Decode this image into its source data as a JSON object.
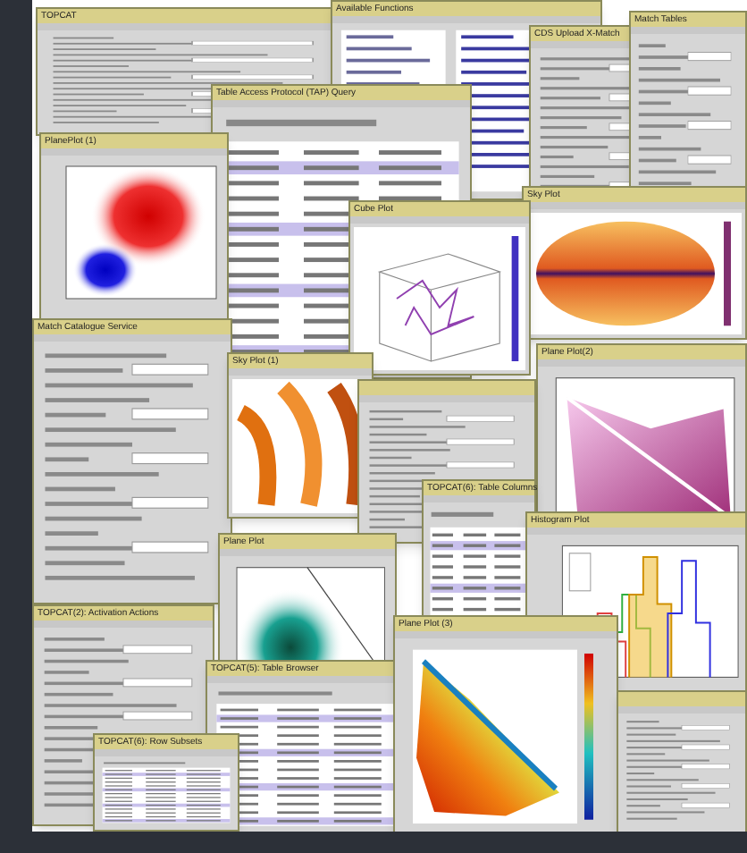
{
  "windows": [
    {
      "title": "TOPCAT",
      "kind": "form"
    },
    {
      "title": "Available Functions",
      "kind": "list"
    },
    {
      "title": "Table Access Protocol (TAP) Query",
      "kind": "table"
    },
    {
      "title": "PlanePlot (1)",
      "kind": "clusters"
    },
    {
      "title": "CDS Upload X-Match",
      "kind": "form"
    },
    {
      "title": "Match Tables",
      "kind": "form"
    },
    {
      "title": "Sky Plot",
      "kind": "sky"
    },
    {
      "title": "Cube Plot",
      "kind": "cube"
    },
    {
      "title": "Match Catalogue Service",
      "kind": "form"
    },
    {
      "title": "Sky Plot (1)",
      "kind": "stripes"
    },
    {
      "title": "Plane Plot(2)",
      "kind": "density"
    },
    {
      "kind": "form"
    },
    {
      "title": "TOPCAT(6): Table Columns",
      "kind": "table"
    },
    {
      "title": "Histogram Plot",
      "kind": "histogram"
    },
    {
      "title": "Plane Plot",
      "kind": "contour"
    },
    {
      "title": "TOPCAT(2): Activation Actions",
      "kind": "form"
    },
    {
      "title": "TOPCAT(5): Table Browser",
      "kind": "table"
    },
    {
      "title": "TOPCAT(6): Row Subsets",
      "kind": "table"
    },
    {
      "title": "Plane Plot (3)",
      "kind": "rainbow"
    },
    {
      "kind": "form"
    }
  ]
}
